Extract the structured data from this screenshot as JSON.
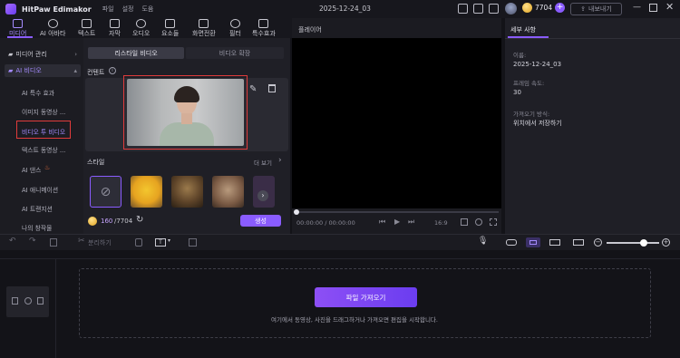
{
  "app": {
    "name": "HitPaw Edimakor",
    "menu": [
      "파일",
      "설정",
      "도움"
    ],
    "project_title": "2025-12-24_03"
  },
  "account": {
    "credits": "7704",
    "export_label": "내보내기"
  },
  "nav_tabs": [
    "미디어",
    "AI 아바타",
    "텍스트",
    "자막",
    "오디오",
    "요소들",
    "화면전환",
    "필터",
    "특수효과"
  ],
  "sidebar": {
    "media_folder": "미디어 관리",
    "ai_video_folder": "AI 비디오",
    "items": [
      "AI 특수 효과",
      "이미지 동영상 ...",
      "비디오 투 비디오",
      "텍스트 동영상 ...",
      "AI 댄스",
      "AI 애니메이션",
      "AI 트랜지션",
      "나의 창작물"
    ]
  },
  "center": {
    "segments": [
      "리스타일 비디오",
      "비디오 확장"
    ],
    "content_label": "컨텐트",
    "style_label": "스타일",
    "more_label": "더 보기",
    "credits_used": "160",
    "credits_total": "/7704",
    "generate_label": "생성"
  },
  "player": {
    "title": "플레이어",
    "time": "00:00:00 / 00:00:00",
    "speed": "16:9"
  },
  "details": {
    "tab": "세부 사항",
    "name_label": "이름:",
    "name_value": "2025-12-24_03",
    "fps_label": "프레임 속도:",
    "fps_value": "30",
    "import_label": "가져오기 방식:",
    "import_value": "위치에서 저장하기"
  },
  "toolbar": {
    "split_label": "분리하기"
  },
  "timeline": {
    "import_button": "파일 가져오기",
    "hint": "여기에서 동영상, 사진을 드래그하거나 가져오면 편집을 시작합니다."
  },
  "colors": {
    "accent": "#8a5cff",
    "highlight_box": "#e03b3b"
  }
}
